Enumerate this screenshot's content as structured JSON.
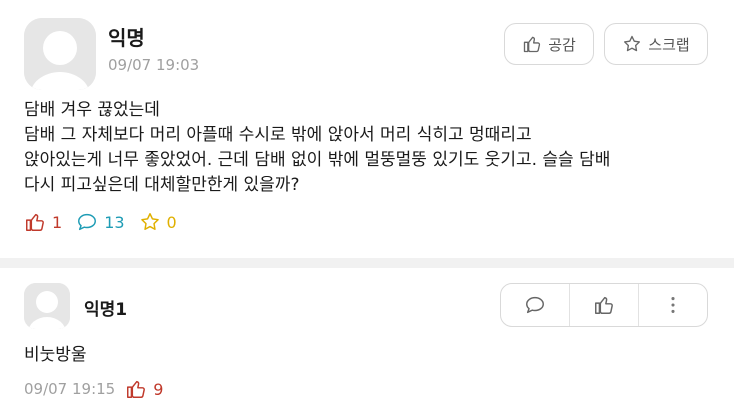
{
  "post": {
    "author": "익명",
    "date": "09/07 19:03",
    "like_button_label": "공감",
    "scrap_button_label": "스크랩",
    "body": "담배 겨우 끊었는데\n담배 그 자체보다 머리 아플때 수시로 밖에 앉아서 머리 식히고 멍때리고\n앉아있는게 너무 좋았었어. 근데 담배 없이 밖에 멀뚱멀뚱 있기도 웃기고. 슬슬 담배\n다시 피고싶은데 대체할만한게 있을까?",
    "likes": "1",
    "comments": "13",
    "scraps": "0"
  },
  "comment": {
    "author": "익명1",
    "body": "비눗방울",
    "date": "09/07 19:15",
    "likes": "9"
  },
  "icons": {
    "avatar": "default-avatar-icon",
    "like": "thumbs-up-icon",
    "scrap": "star-icon",
    "comment": "speech-bubble-icon",
    "more": "vertical-dots-icon"
  },
  "colors": {
    "like": "#c0392b",
    "comment": "#1e9cb5",
    "scrap": "#e0b000",
    "meta_text": "#a0a0a0"
  }
}
